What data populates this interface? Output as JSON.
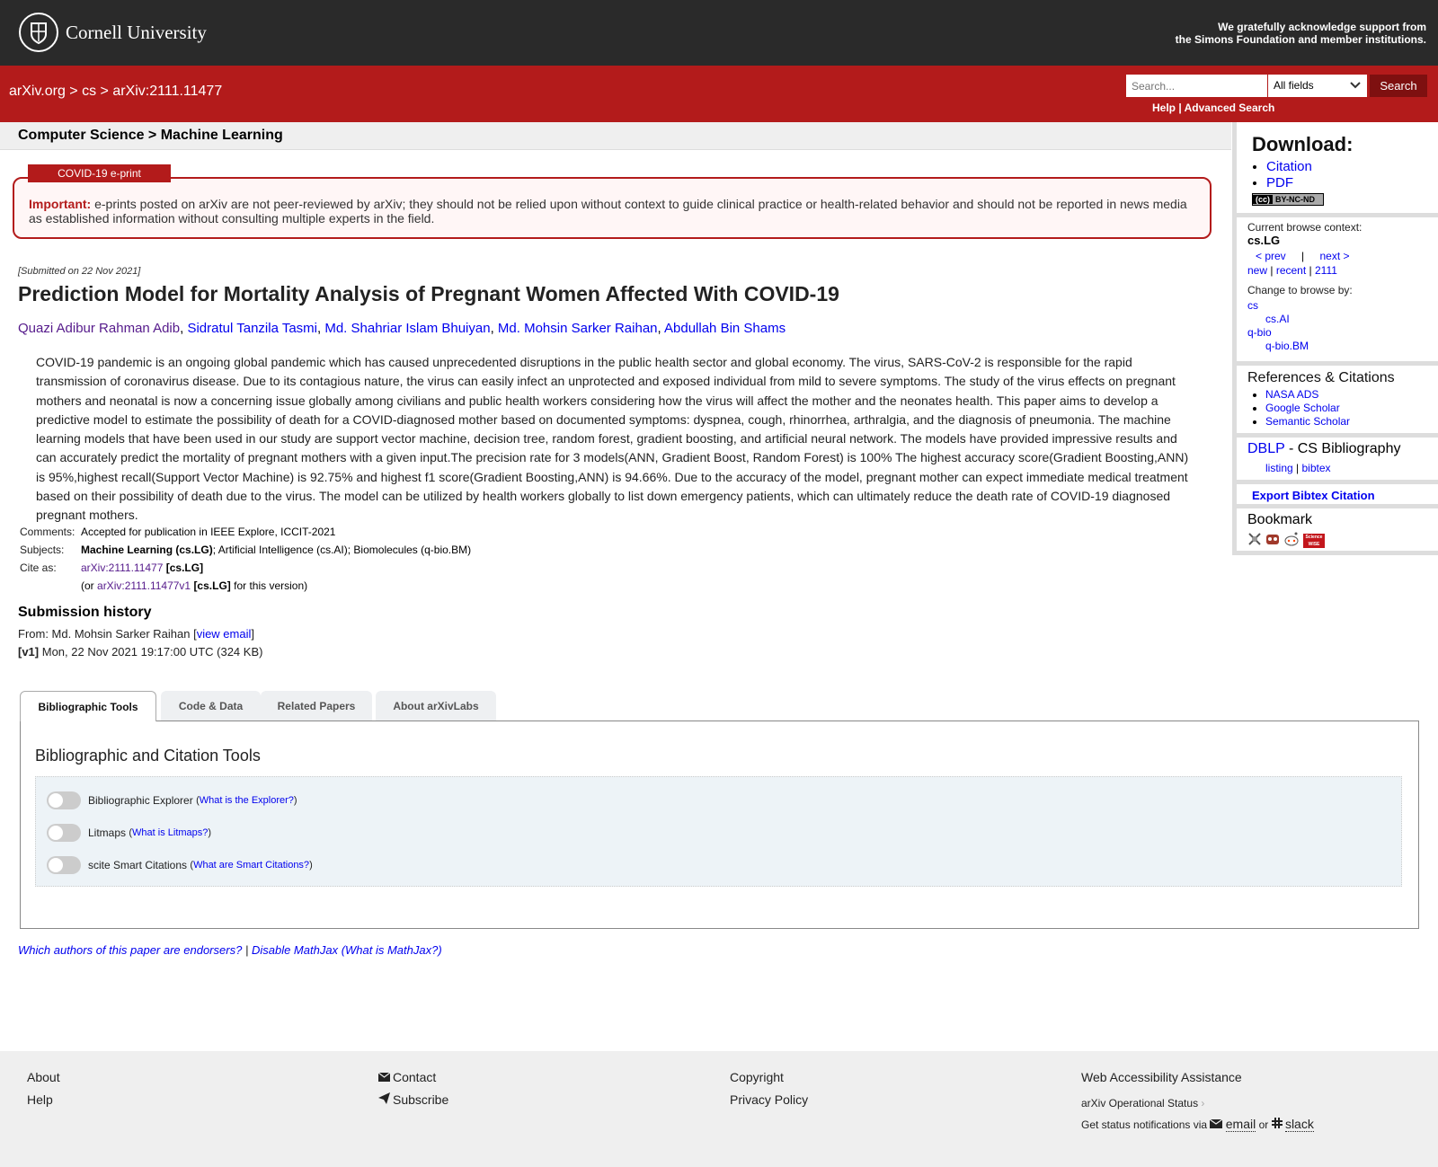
{
  "header": {
    "org_name": "Cornell University",
    "ack_line1": "We gratefully acknowledge support from",
    "ack_line2": "the Simons Foundation and member institutions."
  },
  "nav": {
    "crumb_home": "arXiv.org",
    "crumb_sep": ">",
    "crumb_cat": "cs",
    "crumb_id": "arXiv:2111.11477"
  },
  "search": {
    "placeholder": "Search...",
    "field": "All fields",
    "button": "Search",
    "help": "Help",
    "sep": "|",
    "advanced": "Advanced Search"
  },
  "subject_header": "Computer Science > Machine Learning",
  "covid": {
    "tag": "COVID-19 e-print",
    "important": "Important:",
    "text": "e-prints posted on arXiv are not peer-reviewed by arXiv; they should not be relied upon without context to guide clinical practice or health-related behavior and should not be reported in news media as established information without consulting multiple experts in the field."
  },
  "paper": {
    "submitted": "[Submitted on 22 Nov 2021]",
    "title": "Prediction Model for Mortality Analysis of Pregnant Women Affected With COVID-19",
    "authors": [
      "Quazi Adibur Rahman Adib",
      "Sidratul Tanzila Tasmi",
      "Md. Shahriar Islam Bhuiyan",
      "Md. Mohsin Sarker Raihan",
      "Abdullah Bin Shams"
    ],
    "abstract": "COVID-19 pandemic is an ongoing global pandemic which has caused unprecedented disruptions in the public health sector and global economy. The virus, SARS-CoV-2 is responsible for the rapid transmission of coronavirus disease. Due to its contagious nature, the virus can easily infect an unprotected and exposed individual from mild to severe symptoms. The study of the virus effects on pregnant mothers and neonatal is now a concerning issue globally among civilians and public health workers considering how the virus will affect the mother and the neonates health. This paper aims to develop a predictive model to estimate the possibility of death for a COVID-diagnosed mother based on documented symptoms: dyspnea, cough, rhinorrhea, arthralgia, and the diagnosis of pneumonia. The machine learning models that have been used in our study are support vector machine, decision tree, random forest, gradient boosting, and artificial neural network. The models have provided impressive results and can accurately predict the mortality of pregnant mothers with a given input.The precision rate for 3 models(ANN, Gradient Boost, Random Forest) is 100% The highest accuracy score(Gradient Boosting,ANN) is 95%,highest recall(Support Vector Machine) is 92.75% and highest f1 score(Gradient Boosting,ANN) is 94.66%. Due to the accuracy of the model, pregnant mother can expect immediate medical treatment based on their possibility of death due to the virus. The model can be utilized by health workers globally to list down emergency patients, which can ultimately reduce the death rate of COVID-19 diagnosed pregnant mothers."
  },
  "meta": {
    "comments_label": "Comments:",
    "comments": "Accepted for publication in IEEE Explore, ICCIT-2021",
    "subjects_label": "Subjects:",
    "subject_primary": "Machine Learning (cs.LG)",
    "subject_rest": "; Artificial Intelligence (cs.AI); Biomolecules (q-bio.BM)",
    "cite_label": "Cite as:",
    "cite_id": "arXiv:2111.11477",
    "cite_cat": "[cs.LG]",
    "cite_or": "(or",
    "cite_v1": "arXiv:2111.11477v1",
    "cite_v1_cat": "[cs.LG]",
    "cite_tail": "for this version)"
  },
  "history": {
    "title": "Submission history",
    "from_label": "From: Md. Mohsin Sarker Raihan [",
    "view_email": "view email",
    "from_close": "]",
    "v1": "[v1]",
    "v1_text": "Mon, 22 Nov 2021 19:17:00 UTC (324 KB)"
  },
  "tabs": [
    "Bibliographic Tools",
    "Code & Data",
    "Related Papers",
    "About arXivLabs"
  ],
  "tools": {
    "title": "Bibliographic and Citation Tools",
    "items": [
      {
        "label": "Bibliographic Explorer",
        "help": "What is the Explorer?"
      },
      {
        "label": "Litmaps",
        "help": "What is Litmaps?"
      },
      {
        "label": "scite Smart Citations",
        "help": "What are Smart Citations?"
      }
    ]
  },
  "endorsers": {
    "q": "Which authors of this paper are endorsers?",
    "sep": "|",
    "mathjax": "Disable MathJax",
    "what": "(What is MathJax?)"
  },
  "sidebar": {
    "download": "Download:",
    "citation": "Citation",
    "pdf": "PDF",
    "license": "BY-NC-ND",
    "browse_context": "Current browse context:",
    "context": "cs.LG",
    "prev": "< prev",
    "bar": "|",
    "next": "next >",
    "new": "new",
    "recent": "recent",
    "month": "2111",
    "change_browse": "Change to browse by:",
    "cs": "cs",
    "csai": "cs.AI",
    "qbio": "q-bio",
    "qbiobm": "q-bio.BM",
    "refs_title": "References & Citations",
    "refs": [
      "NASA ADS",
      "Google Scholar",
      "Semantic Scholar"
    ],
    "dblp": "DBLP",
    "dblp_rest": " - CS Bibliography",
    "listing": "listing",
    "bibtex": "bibtex",
    "export": "Export Bibtex Citation",
    "bookmark": "Bookmark",
    "sciencewise": "Science WISE"
  },
  "footer": {
    "about": "About",
    "help": "Help",
    "contact": "Contact",
    "subscribe": "Subscribe",
    "copyright": "Copyright",
    "privacy": "Privacy Policy",
    "accessibility": "Web Accessibility Assistance",
    "status": "arXiv Operational Status",
    "notify": "Get status notifications via",
    "email": "email",
    "or": "or",
    "slack": "slack"
  },
  "colors": {
    "arxiv_red": "#b31b1b",
    "dark_bar": "#2a2a2a",
    "link": "#0000ee"
  }
}
